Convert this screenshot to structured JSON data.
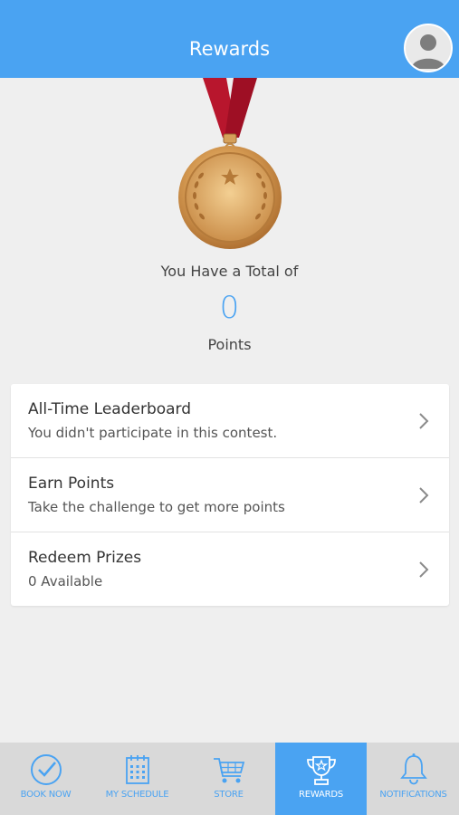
{
  "header": {
    "title": "Rewards"
  },
  "points": {
    "label": "You Have a Total of",
    "value": "0",
    "unit": "Points"
  },
  "list": [
    {
      "title": "All-Time Leaderboard",
      "subtitle": "You didn't participate in this contest."
    },
    {
      "title": "Earn Points",
      "subtitle": "Take the challenge to get more points"
    },
    {
      "title": "Redeem Prizes",
      "subtitle": "0 Available"
    }
  ],
  "nav": [
    {
      "label": "BOOK NOW",
      "icon": "check-circle-icon"
    },
    {
      "label": "MY SCHEDULE",
      "icon": "calendar-icon"
    },
    {
      "label": "STORE",
      "icon": "cart-icon"
    },
    {
      "label": "REWARDS",
      "icon": "trophy-icon",
      "active": true
    },
    {
      "label": "NOTIFICATIONS",
      "icon": "bell-icon"
    }
  ],
  "colors": {
    "accent": "#4aa3f2",
    "background": "#efefef",
    "ribbon": "#b8162d",
    "medal_gold": "#d9a25a"
  }
}
